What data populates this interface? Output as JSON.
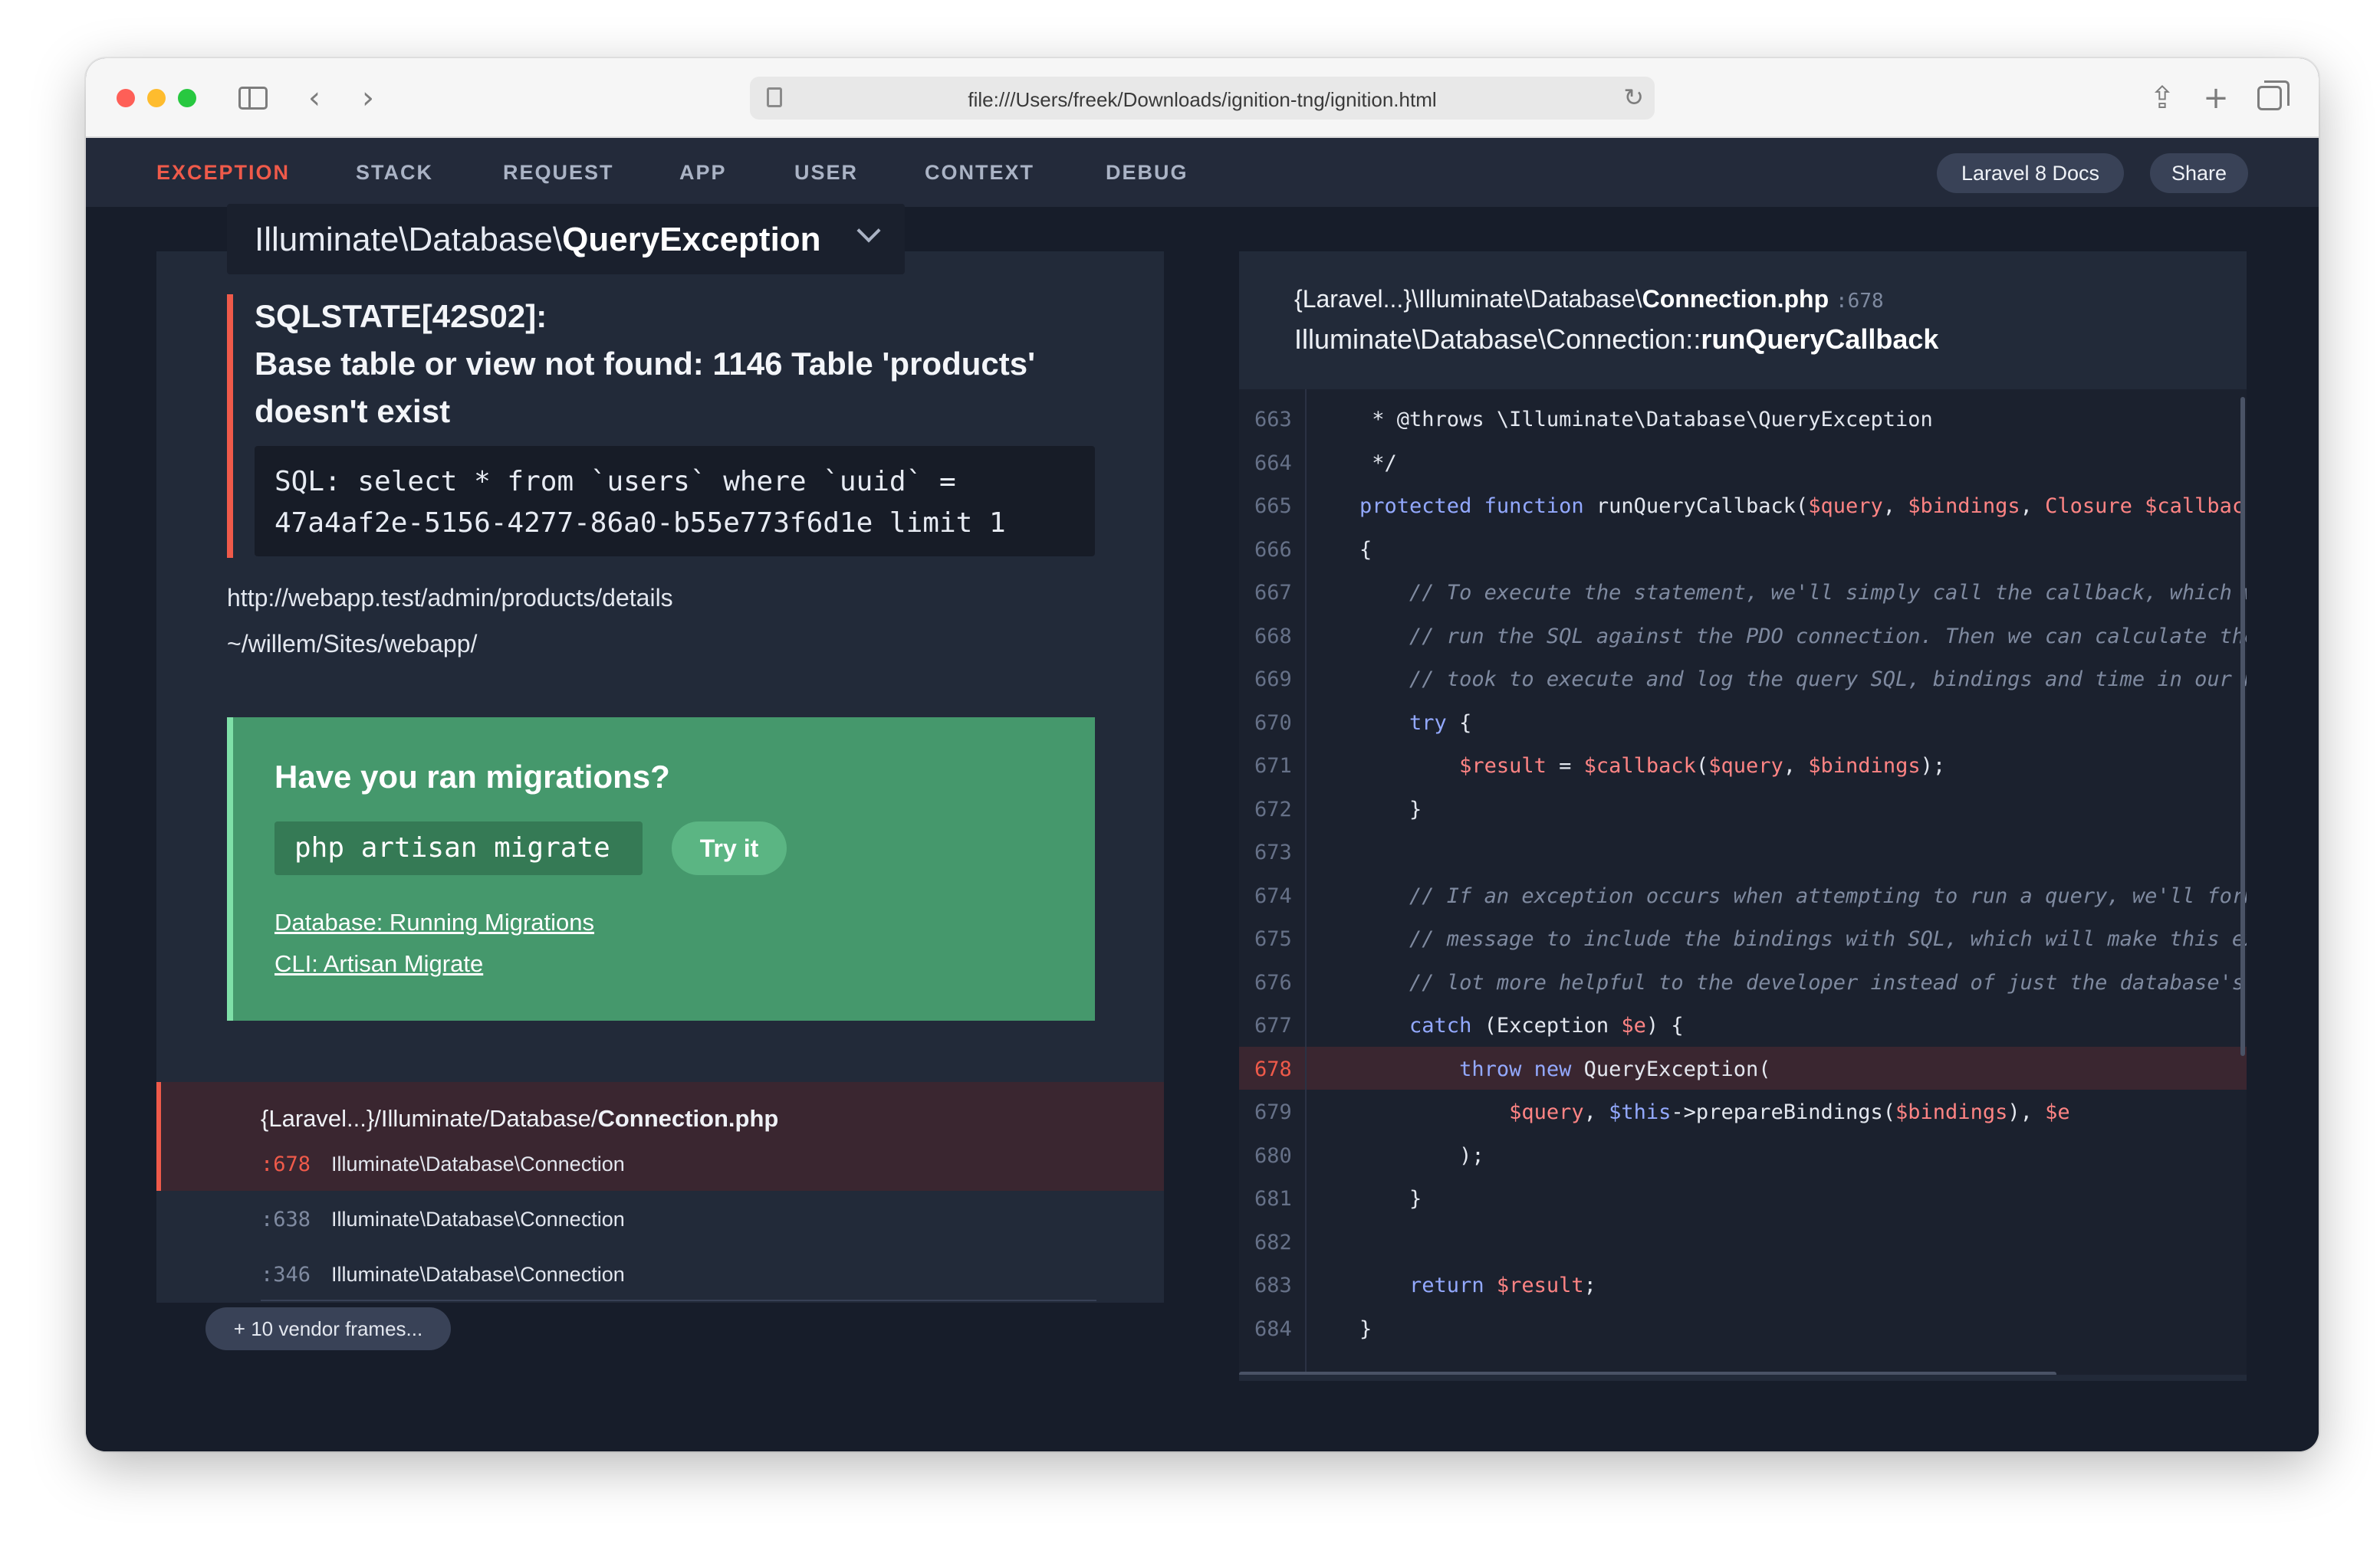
{
  "browser": {
    "url": "file:///Users/freek/Downloads/ignition-tng/ignition.html"
  },
  "nav": {
    "items": [
      "EXCEPTION",
      "STACK",
      "REQUEST",
      "APP",
      "USER",
      "CONTEXT",
      "DEBUG"
    ],
    "docs_button": "Laravel 8 Docs",
    "share_button": "Share"
  },
  "exception": {
    "class_prefix": "Illuminate\\Database\\",
    "class_name": "QueryException",
    "message_line1": "SQLSTATE[42S02]:",
    "message_line2": "Base table or view not found: 1146 Table 'products' doesn't exist",
    "sql": "SQL: select * from `users` where `uuid` = 47a4af2e-5156-4277-86a0-b55e773f6d1e limit 1",
    "url": "http://webapp.test/admin/products/details",
    "path": "~/willem/Sites/webapp/"
  },
  "solution": {
    "title": "Have you ran migrations?",
    "command": "php artisan migrate",
    "try_button": "Try it",
    "links": [
      "Database: Running Migrations",
      "CLI: Artisan Migrate"
    ]
  },
  "frames": {
    "active_file_prefix": "{Laravel...}/Illuminate/Database/",
    "active_file_name": "Connection.php",
    "items": [
      {
        "line": ":678",
        "class": "Illuminate\\Database\\Connection"
      },
      {
        "line": ":638",
        "class": "Illuminate\\Database\\Connection"
      },
      {
        "line": ":346",
        "class": "Illuminate\\Database\\Connection"
      }
    ],
    "vendor_button": "+ 10 vendor frames..."
  },
  "code": {
    "file_prefix": "{Laravel...}\\Illuminate\\Database\\",
    "file_name": "Connection.php",
    "file_line": ":678",
    "method_prefix": "Illuminate\\Database\\Connection::",
    "method_name": "runQueryCallback",
    "highlight_line": 678,
    "lines": [
      {
        "n": "663",
        "segs": [
          [
            "",
            "     * @throws \\Illuminate\\Database\\QueryException"
          ]
        ]
      },
      {
        "n": "664",
        "segs": [
          [
            "",
            "     */"
          ]
        ]
      },
      {
        "n": "665",
        "segs": [
          [
            "kw",
            "    protected function "
          ],
          [
            "",
            "runQueryCallback("
          ],
          [
            "var",
            "$query"
          ],
          [
            "",
            ", "
          ],
          [
            "var",
            "$bindings"
          ],
          [
            "",
            ", "
          ],
          [
            "var",
            "Closure $callback"
          ],
          [
            "",
            ")"
          ]
        ]
      },
      {
        "n": "666",
        "segs": [
          [
            "",
            "    {"
          ]
        ]
      },
      {
        "n": "667",
        "segs": [
          [
            "cm",
            "        // To execute the statement, we'll simply call the callback, which will"
          ]
        ]
      },
      {
        "n": "668",
        "segs": [
          [
            "cm",
            "        // run the SQL against the PDO connection. Then we can calculate the time"
          ]
        ]
      },
      {
        "n": "669",
        "segs": [
          [
            "cm",
            "        // took to execute and log the query SQL, bindings and time in our memory."
          ]
        ]
      },
      {
        "n": "670",
        "segs": [
          [
            "kw",
            "        try "
          ],
          [
            "",
            "{"
          ]
        ]
      },
      {
        "n": "671",
        "segs": [
          [
            "var",
            "            $result"
          ],
          [
            "",
            " = "
          ],
          [
            "var",
            "$callback"
          ],
          [
            "",
            "("
          ],
          [
            "var",
            "$query"
          ],
          [
            "",
            ", "
          ],
          [
            "var",
            "$bindings"
          ],
          [
            "",
            ");"
          ]
        ]
      },
      {
        "n": "672",
        "segs": [
          [
            "",
            "        }"
          ]
        ]
      },
      {
        "n": "673",
        "segs": [
          [
            "",
            ""
          ]
        ]
      },
      {
        "n": "674",
        "segs": [
          [
            "cm",
            "        // If an exception occurs when attempting to run a query, we'll format the error"
          ]
        ]
      },
      {
        "n": "675",
        "segs": [
          [
            "cm",
            "        // message to include the bindings with SQL, which will make this exception a"
          ]
        ]
      },
      {
        "n": "676",
        "segs": [
          [
            "cm",
            "        // lot more helpful to the developer instead of just the database's errors."
          ]
        ]
      },
      {
        "n": "677",
        "segs": [
          [
            "kw",
            "        catch "
          ],
          [
            "",
            "(Exception "
          ],
          [
            "var",
            "$e"
          ],
          [
            "",
            ") {"
          ]
        ]
      },
      {
        "n": "678",
        "segs": [
          [
            "kw",
            "            throw new "
          ],
          [
            "",
            "QueryException("
          ]
        ]
      },
      {
        "n": "679",
        "segs": [
          [
            "var",
            "                $query"
          ],
          [
            "",
            ", "
          ],
          [
            "kw",
            "$this"
          ],
          [
            "",
            "->prepareBindings("
          ],
          [
            "var",
            "$bindings"
          ],
          [
            "",
            "), "
          ],
          [
            "var",
            "$e"
          ]
        ]
      },
      {
        "n": "680",
        "segs": [
          [
            "",
            "            );"
          ]
        ]
      },
      {
        "n": "681",
        "segs": [
          [
            "",
            "        }"
          ]
        ]
      },
      {
        "n": "682",
        "segs": [
          [
            "",
            ""
          ]
        ]
      },
      {
        "n": "683",
        "segs": [
          [
            "kw",
            "        return "
          ],
          [
            "var",
            "$result"
          ],
          [
            "",
            ";"
          ]
        ]
      },
      {
        "n": "684",
        "segs": [
          [
            "",
            "    }"
          ]
        ]
      }
    ]
  },
  "colors": {
    "accent_red": "#ef5a4a",
    "solution_green": "#45986c",
    "background": "#171d2a"
  }
}
